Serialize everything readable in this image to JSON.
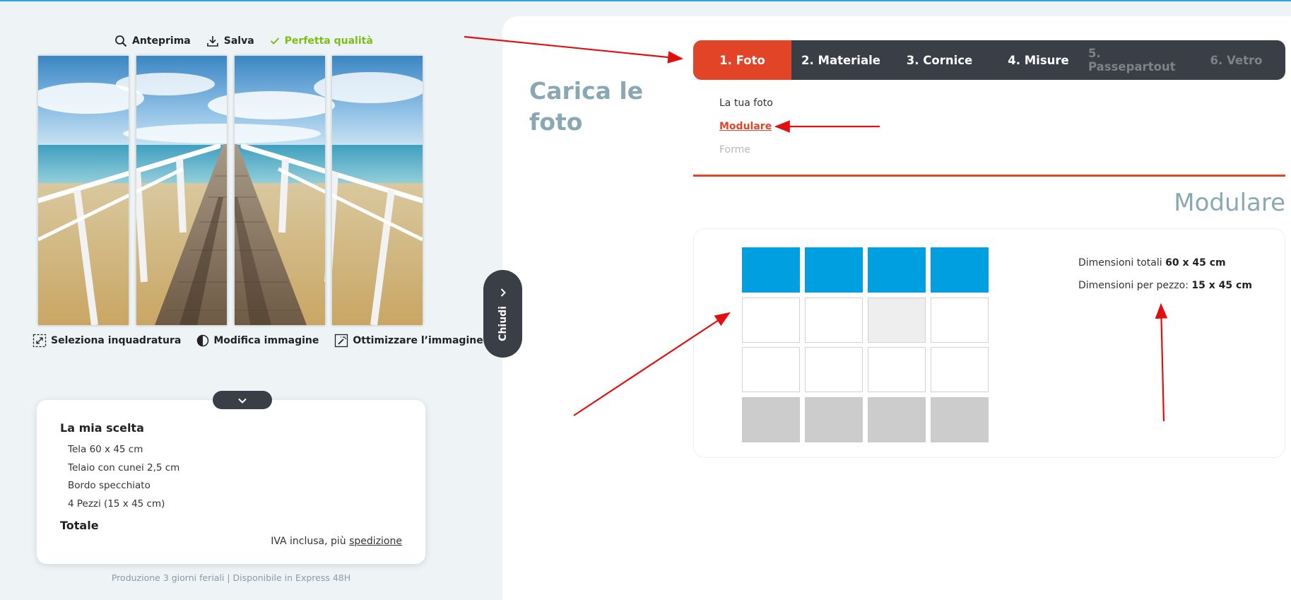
{
  "toolbar": {
    "preview_label": "Anteprima",
    "save_label": "Salva",
    "quality_label": "Perfetta qualità"
  },
  "image_actions": {
    "crop_label": "Seleziona inquadratura",
    "edit_label": "Modifica immagine",
    "optimize_label": "Ottimizzare l’immagine"
  },
  "summary": {
    "title": "La mia scelta",
    "items": [
      "Tela 60 x 45 cm",
      "Telaio con cunei 2,5 cm",
      "Bordo specchiato",
      "4 Pezzi (15 x 45 cm)"
    ],
    "total_label": "Totale",
    "vat_text": "IVA inclusa, più",
    "shipping_link": "spedizione"
  },
  "footer_note": "Produzione 3 giorni feriali | Disponibile in Express 48H",
  "close_tab_label": "Chiudi",
  "page_heading": "Carica le foto",
  "steps": [
    {
      "label": "1. Foto",
      "state": "active"
    },
    {
      "label": "2. Materiale",
      "state": "enabled"
    },
    {
      "label": "3. Cornice",
      "state": "enabled"
    },
    {
      "label": "4. Misure",
      "state": "enabled"
    },
    {
      "label": "5. Passepartout",
      "state": "disabled"
    },
    {
      "label": "6. Vetro",
      "state": "disabled"
    }
  ],
  "subnav": {
    "item1": "La tua foto",
    "item2": "Modulare",
    "item3": "Forme"
  },
  "section_title": "Modulare",
  "module_grid": {
    "rows": [
      [
        "selected",
        "selected",
        "selected",
        "selected"
      ],
      [
        "empty",
        "empty",
        "highlight",
        "empty"
      ],
      [
        "empty",
        "empty",
        "empty",
        "empty"
      ],
      [
        "disabled",
        "disabled",
        "disabled",
        "disabled"
      ]
    ]
  },
  "dimensions": {
    "total_label": "Dimensioni totali",
    "total_value": "60 x 45 cm",
    "piece_label": "Dimensioni per pezzo:",
    "piece_value": "15 x 45 cm"
  },
  "colors": {
    "accent": "#e24427",
    "module_selected": "#009fe0",
    "quality_ok": "#7fbd14",
    "step_bar": "#3a3f47",
    "heading": "#8aa8b3",
    "annotation_arrow": "#e01010"
  }
}
